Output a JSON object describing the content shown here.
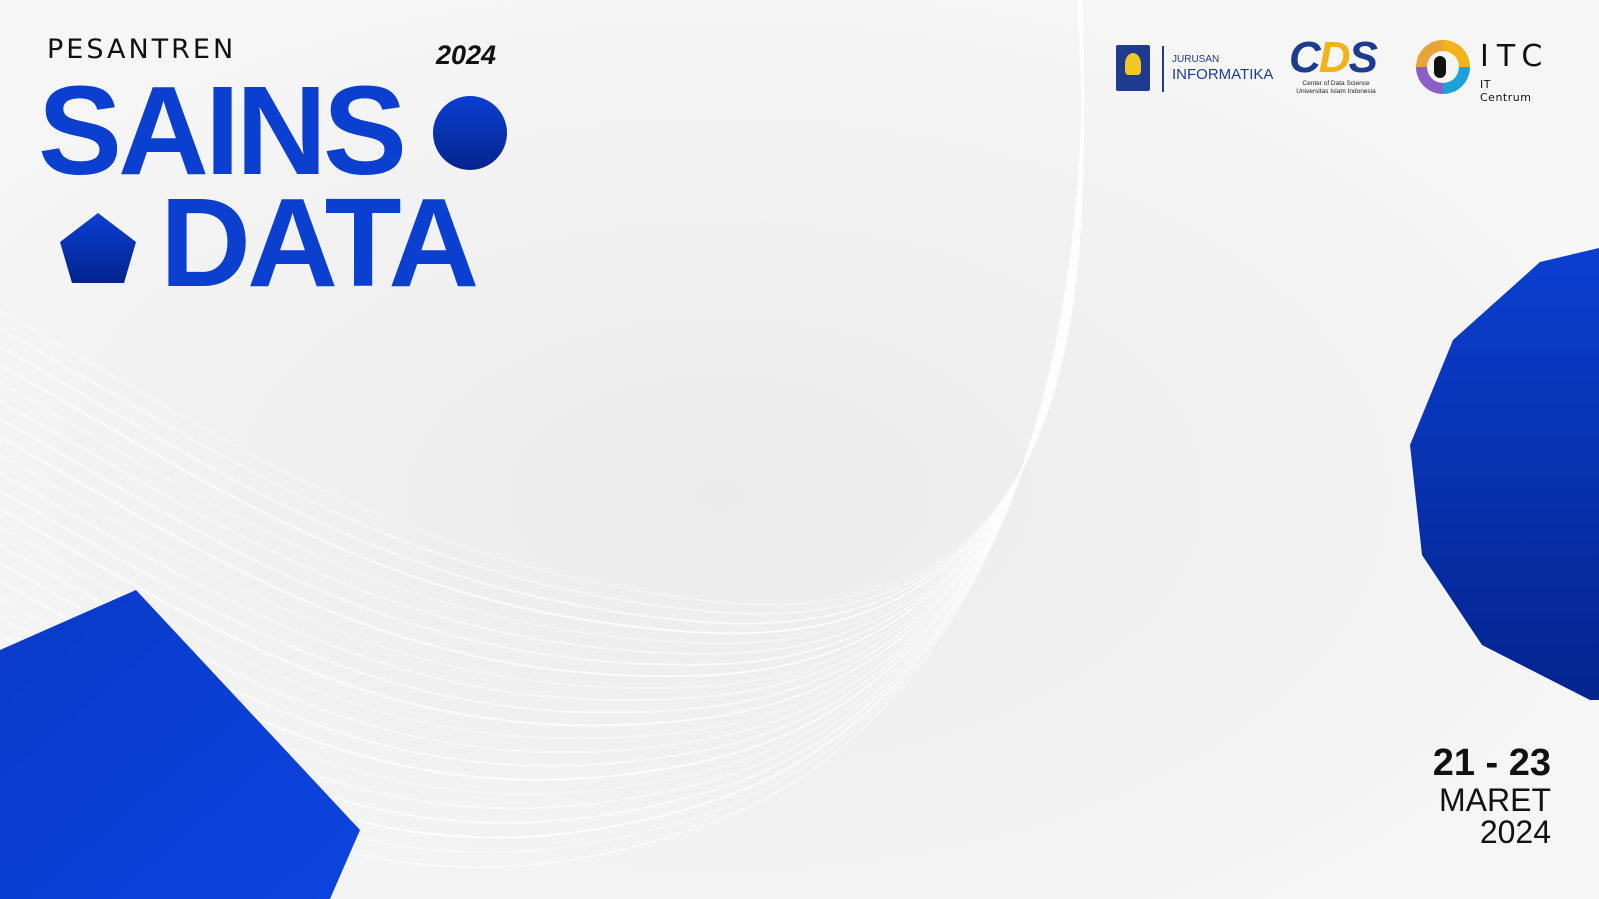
{
  "event": {
    "kicker": "PESANTREN",
    "year": "2024",
    "title_line1": "SAINS",
    "title_line2": "DATA"
  },
  "date": {
    "days": "21 - 23",
    "month": "MARET",
    "year": "2024"
  },
  "logos": [
    {
      "name": "jurusan-informatika",
      "small": "JURUSAN",
      "big": "INFORMATIKA",
      "color": "#1e3c8f"
    },
    {
      "name": "cds",
      "mark": "CDS",
      "sub": "Center of Data Science Universitas Islam Indonesia",
      "colors": [
        "#1e3c8f",
        "#f3b21b"
      ]
    },
    {
      "name": "itc",
      "big": "ITC",
      "small": "IT Centrum"
    }
  ],
  "colors": {
    "background": "#f4f4f4",
    "brand_blue": "#0b3fd0",
    "brand_blue_dark": "#052a9b",
    "text": "#111111"
  }
}
